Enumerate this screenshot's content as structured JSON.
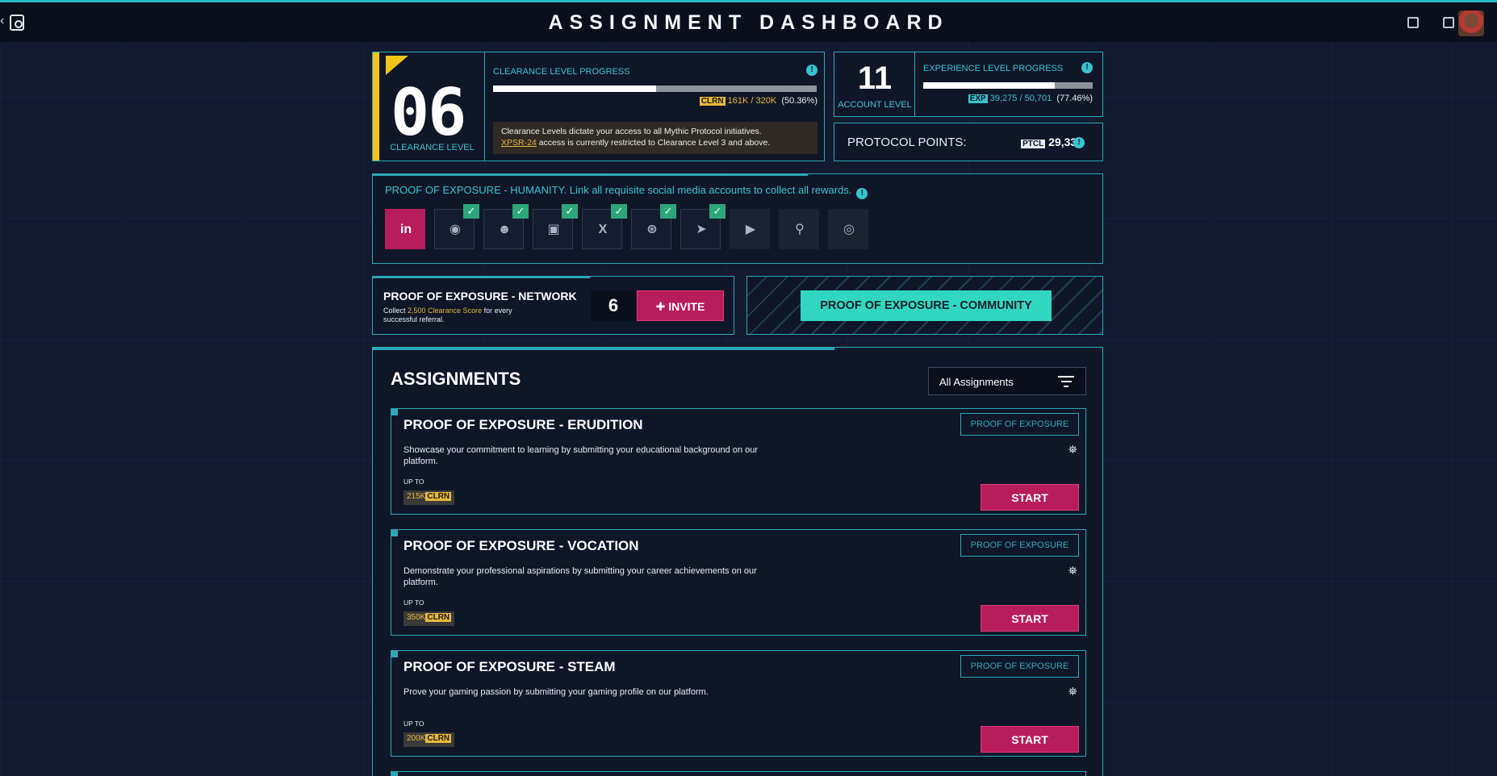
{
  "header": {
    "title": "ASSIGNMENT DASHBOARD",
    "icons": [
      "back-icon",
      "app-logo-icon",
      "help-icon",
      "chat-icon",
      "avatar"
    ]
  },
  "clearance": {
    "level": "06",
    "level_label": "CLEARANCE LEVEL",
    "progress_label": "CLEARANCE LEVEL PROGRESS",
    "progress_fraction": 0.5036,
    "tag": "CLRN",
    "progress_value": "161K / 320K",
    "progress_percent": "(50.36%)",
    "notice_text": "Clearance Levels dictate your access to all Mythic Protocol initiatives.",
    "notice_link": "XPSR-24",
    "notice_tail": " access is currently restricted to Clearance Level 3 and above."
  },
  "account": {
    "level": "11",
    "level_label": "ACCOUNT LEVEL",
    "progress_label": "EXPERIENCE LEVEL PROGRESS",
    "progress_fraction": 0.7746,
    "tag": "EXP",
    "progress_value": "39,275 / 50,701",
    "progress_percent": "(77.46%)"
  },
  "protocol": {
    "label": "PROTOCOL POINTS:",
    "tag": "PTCL",
    "value": "29,337"
  },
  "humanity": {
    "text": "PROOF OF EXPOSURE - HUMANITY. Link all requisite social media accounts to collect all rewards.",
    "accounts": [
      {
        "name": "linkedin",
        "glyph": "in",
        "state": "active",
        "linked": false
      },
      {
        "name": "reddit",
        "glyph": "◉",
        "state": "linked",
        "linked": true
      },
      {
        "name": "discord",
        "glyph": "☻",
        "state": "linked",
        "linked": true
      },
      {
        "name": "twitch",
        "glyph": "▣",
        "state": "linked",
        "linked": true
      },
      {
        "name": "x",
        "glyph": "X",
        "state": "linked",
        "linked": true
      },
      {
        "name": "steam",
        "glyph": "⊛",
        "state": "linked",
        "linked": true
      },
      {
        "name": "telegram",
        "glyph": "➤",
        "state": "linked",
        "linked": true
      },
      {
        "name": "youtube",
        "glyph": "▶",
        "state": "plain",
        "linked": false
      },
      {
        "name": "user-search",
        "glyph": "⚲",
        "state": "plain",
        "linked": false
      },
      {
        "name": "instagram",
        "glyph": "◎",
        "state": "plain",
        "linked": false
      }
    ],
    "check": "✓"
  },
  "network": {
    "title": "PROOF OF EXPOSURE - NETWORK",
    "sub_pre": "Collect ",
    "sub_highlight": "2,500 Clearance Score",
    "sub_post": " for every successful referral.",
    "count": "6",
    "invite_label": "INVITE"
  },
  "community": {
    "button_label": "PROOF OF EXPOSURE - COMMUNITY"
  },
  "assignments": {
    "title": "ASSIGNMENTS",
    "filter_label": "All Assignments",
    "items": [
      {
        "title": "PROOF OF EXPOSURE - ERUDITION",
        "tag": "PROOF OF EXPOSURE",
        "description": "Showcase your commitment to learning by submitting your educational background on our platform.",
        "up_to": "UP TO",
        "amount": "215K",
        "currency": "CLRN",
        "start": "START"
      },
      {
        "title": "PROOF OF EXPOSURE - VOCATION",
        "tag": "PROOF OF EXPOSURE",
        "description": "Demonstrate your professional aspirations by submitting your career achievements on our platform.",
        "up_to": "UP TO",
        "amount": "350K",
        "currency": "CLRN",
        "start": "START"
      },
      {
        "title": "PROOF OF EXPOSURE - STEAM",
        "tag": "PROOF OF EXPOSURE",
        "description": "Prove your gaming passion by submitting your gaming profile on our platform.",
        "up_to": "UP TO",
        "amount": "200K",
        "currency": "CLRN",
        "start": "START"
      }
    ]
  },
  "colors": {
    "accent": "#2aa8b8",
    "pink": "#b81d5b",
    "gold": "#e9b83a",
    "community": "#31d6c0"
  }
}
